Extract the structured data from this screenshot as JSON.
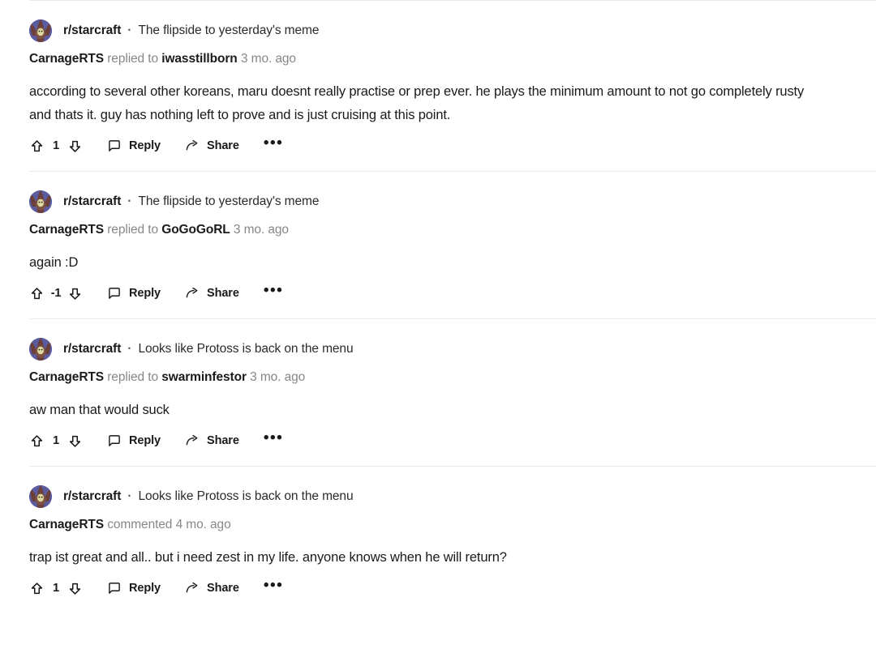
{
  "page": {
    "platform": "reddit-comments-feed",
    "background_color": "#ffffff",
    "divider_color": "#e8e8ea",
    "text_color": "#1a1a1b",
    "muted_text_color": "#87878b"
  },
  "icons": {
    "upvote": "upvote-arrow-icon",
    "downvote": "downvote-arrow-icon",
    "reply": "comment-bubble-icon",
    "share": "share-arrow-icon",
    "more": "more-options-icon",
    "avatar": "subreddit-avatar-icon"
  },
  "labels": {
    "reply": "Reply",
    "share": "Share",
    "more": "•••",
    "separator": "·"
  },
  "comments": [
    {
      "subreddit": "r/starcraft",
      "post_title": "The flipside to yesterday's meme",
      "author": "CarnageRTS",
      "verb": "replied to",
      "target_user": "iwasstillborn",
      "timestamp": "3 mo. ago",
      "body": "according to several other koreans, maru doesnt really practise or prep ever. he plays the minimum amount to not go completely rusty and thats it. guy has nothing left to prove and is just cruising at this point.",
      "votes": "1"
    },
    {
      "subreddit": "r/starcraft",
      "post_title": "The flipside to yesterday's meme",
      "author": "CarnageRTS",
      "verb": "replied to",
      "target_user": "GoGoGoRL",
      "timestamp": "3 mo. ago",
      "body": "again :D",
      "votes": "-1"
    },
    {
      "subreddit": "r/starcraft",
      "post_title": "Looks like Protoss is back on the menu",
      "author": "CarnageRTS",
      "verb": "replied to",
      "target_user": "swarminfestor",
      "timestamp": "3 mo. ago",
      "body": "aw man that would suck",
      "votes": "1"
    },
    {
      "subreddit": "r/starcraft",
      "post_title": "Looks like Protoss is back on the menu",
      "author": "CarnageRTS",
      "verb": "commented",
      "target_user": "",
      "timestamp": "4 mo. ago",
      "body": "trap ist great and all.. but i need zest in my life. anyone knows when he will return?",
      "votes": "1"
    }
  ]
}
